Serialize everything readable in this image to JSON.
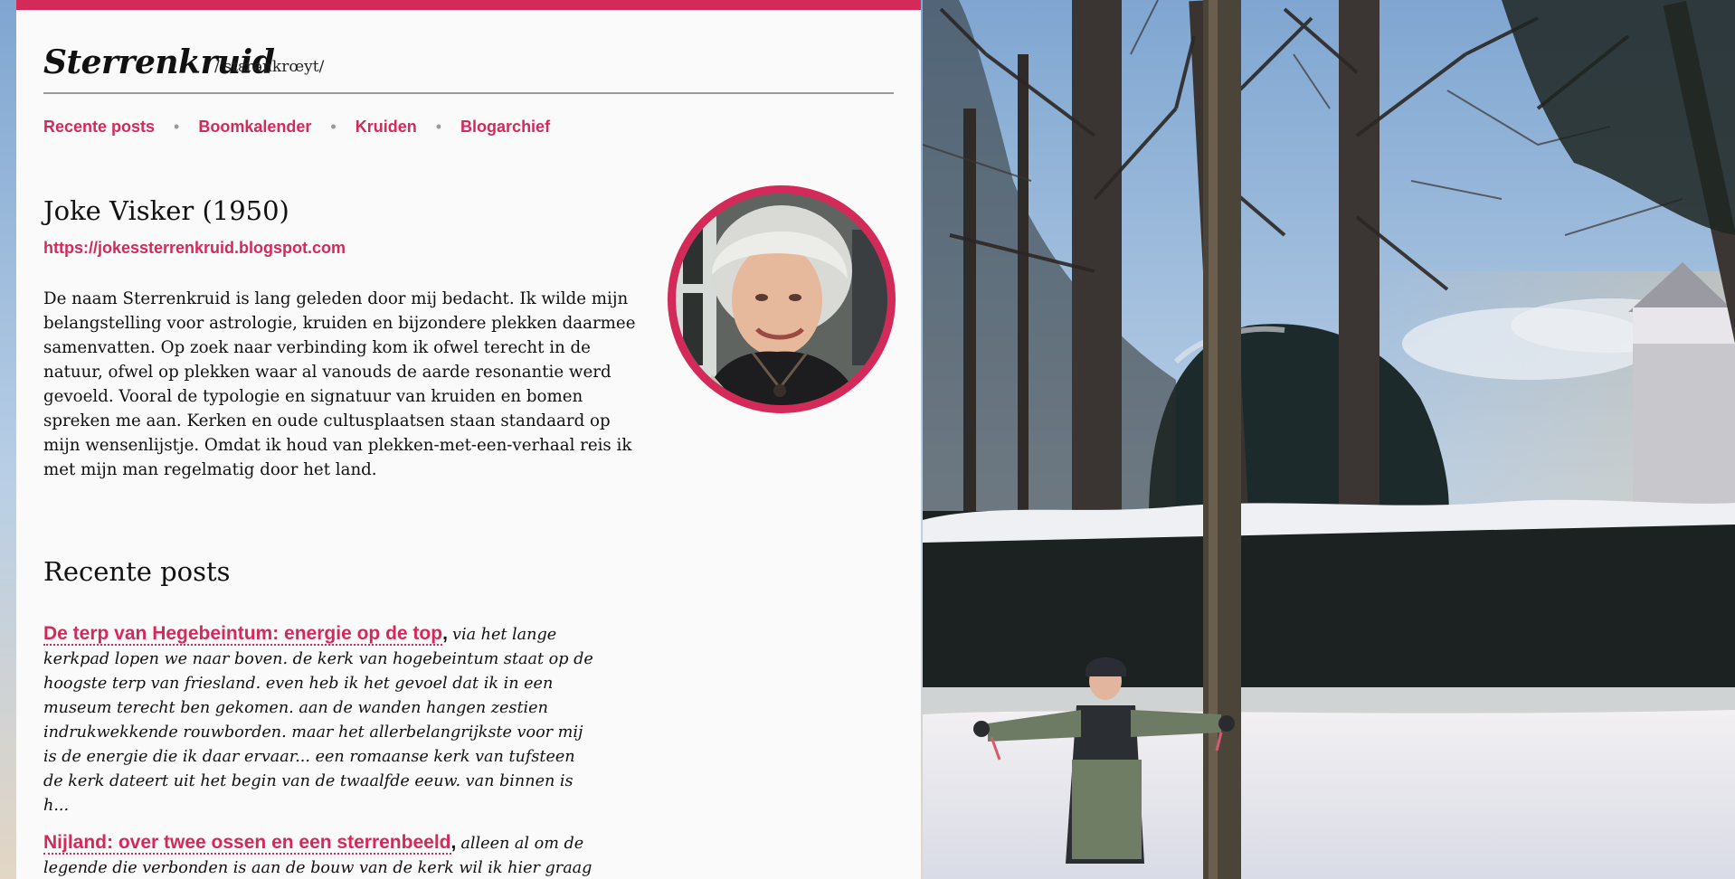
{
  "site": {
    "title": "Sterrenkruid",
    "phonetic": "/'stɛrənkrœyt/",
    "accent_color": "#d42a59"
  },
  "nav": {
    "items": [
      {
        "label": "Recente posts"
      },
      {
        "label": "Boomkalender"
      },
      {
        "label": "Kruiden"
      },
      {
        "label": "Blogarchief"
      }
    ],
    "separator": "•"
  },
  "author": {
    "name": "Joke Visker (1950)",
    "url": "https://jokessterrenkruid.blogspot.com",
    "bio": "De naam Sterrenkruid is lang geleden door mij bedacht. Ik wilde mijn belangstelling voor astrologie, kruiden en bijzondere plekken daarmee samenvatten. Op zoek naar verbinding kom ik ofwel terecht in de natuur, ofwel op plekken waar al vanouds de aarde resonantie werd gevoeld. Vooral de typologie en signatuur van kruiden en bomen spreken me aan. Kerken en oude cultusplaatsen staan standaard op mijn wensenlijstje. Omdat ik houd van plekken-met-een-verhaal reis ik met mijn man regelmatig door het land."
  },
  "recent": {
    "heading": "Recente posts",
    "posts": [
      {
        "title": "De terp van Hegebeintum: energie op de top",
        "excerpt": "via het lange kerkpad lopen we naar boven. de kerk van hogebeintum staat op de hoogste terp van friesland. even heb ik het gevoel dat ik in een museum terecht ben gekomen. aan de wanden hangen zestien indrukwekkende rouwborden. maar het allerbelangrijkste voor mij is de energie die ik daar ervaar... een romaanse kerk van tufsteen de kerk dateert uit het begin van de twaalfde eeuw. van binnen is h..."
      },
      {
        "title": "Nijland: over twee ossen en een sterrenbeeld",
        "excerpt": "alleen al om de legende die verbonden is aan de bouw van de kerk wil ik hier graag naar"
      }
    ]
  }
}
